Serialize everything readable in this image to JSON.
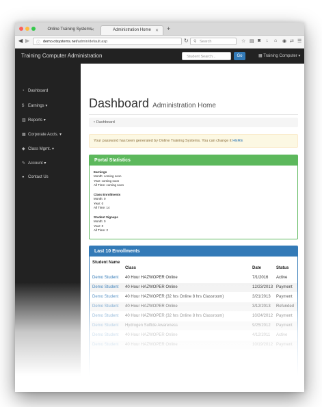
{
  "browser": {
    "tabs": [
      {
        "label": "Online Training Systems",
        "active": false
      },
      {
        "label": "Administration Home",
        "active": true
      }
    ],
    "url_domain": "demo.otsystems.net",
    "url_path": "/admin/default.asp",
    "search_placeholder": "Search"
  },
  "app": {
    "brand": "Training Computer Administration",
    "student_search_placeholder": "Student Search...",
    "go_label": "Go",
    "user_menu": "Training Computer"
  },
  "sidebar": {
    "items": [
      {
        "label": "Dashboard",
        "icon": "dashboard-icon",
        "dropdown": false
      },
      {
        "label": "Earnings",
        "icon": "dollar-icon",
        "dropdown": true
      },
      {
        "label": "Reports",
        "icon": "bar-chart-icon",
        "dropdown": true
      },
      {
        "label": "Corporate Accts.",
        "icon": "building-icon",
        "dropdown": true
      },
      {
        "label": "Class Mgmt.",
        "icon": "mortarboard-icon",
        "dropdown": true
      },
      {
        "label": "Account",
        "icon": "wrench-icon",
        "dropdown": true
      },
      {
        "label": "Contact Us",
        "icon": "comment-icon",
        "dropdown": false
      }
    ]
  },
  "main": {
    "title": "Dashboard",
    "subtitle": "Administration Home",
    "breadcrumb": "Dashboard",
    "alert_text": "Your password has been generated by Online Training Systems. You can change it",
    "alert_link": "HERE",
    "stats_panel": {
      "title": "Portal Statistics",
      "earnings": {
        "heading": "Earnings",
        "month": "Month: coming soon",
        "year": "Year: coming soon",
        "all_time": "All Time: coming soon"
      },
      "enrollments": {
        "heading": "Class Enrollments",
        "month": "Month: 0",
        "year": "Year: 0",
        "all_time": "All Time: 14"
      },
      "signups": {
        "heading": "Student Signups",
        "month": "Month: 0",
        "year": "Year: 0",
        "all_time": "All Time: 2"
      }
    },
    "enrollments_panel": {
      "title": "Last 10 Enrollments",
      "columns": [
        "Student Name",
        "Class",
        "Date",
        "Status"
      ],
      "rows": [
        [
          "Demo Student",
          "40 Hour HAZWOPER Online",
          "7/1/2016",
          "Active"
        ],
        [
          "Demo Student",
          "40 Hour HAZWOPER Online",
          "12/23/2013",
          "Payment"
        ],
        [
          "Demo Student",
          "40 Hour HAZWOPER (32 hrs Online 8 hrs Classroom)",
          "3/21/2013",
          "Payment"
        ],
        [
          "Demo Student",
          "40 Hour HAZWOPER Online",
          "3/12/2013",
          "Refunded"
        ],
        [
          "Demo Student",
          "40 Hour HAZWOPER (32 hrs Online 8 hrs Classroom)",
          "10/24/2012",
          "Payment"
        ],
        [
          "Demo Student",
          "Hydrogen Sulfide Awareness",
          "9/25/2012",
          "Payment"
        ],
        [
          "Demo Student",
          "40 Hour HAZWOPER Online",
          "4/12/2011",
          "Active"
        ],
        [
          "Demo Student",
          "40 Hour HAZWOPER Online",
          "10/19/2012",
          "Payment"
        ]
      ]
    }
  }
}
